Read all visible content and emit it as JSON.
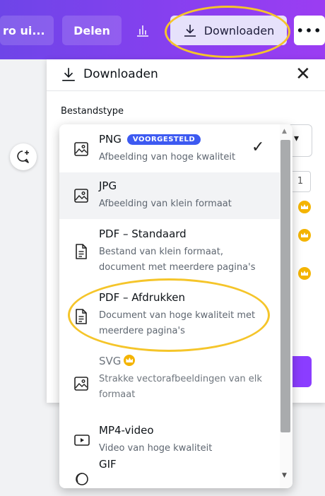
{
  "topbar": {
    "trial_label": "ro ui...",
    "share_label": "Delen",
    "insights_icon": "bar-chart-icon",
    "download_label": "Downloaden",
    "more_label": "•••"
  },
  "panel": {
    "title": "Downloaden",
    "filetype_label": "Bestandstype",
    "size_value": "1",
    "close_icon": "close-icon"
  },
  "file_types": [
    {
      "title": "PNG",
      "badge": "VOORGESTELD",
      "desc": "Afbeelding van hoge kwaliteit",
      "icon": "image-icon",
      "selected": true
    },
    {
      "title": "JPG",
      "desc": "Afbeelding van klein formaat",
      "icon": "image-icon"
    },
    {
      "title": "PDF – Standaard",
      "desc": "Bestand van klein formaat, document met meerdere pagina's",
      "icon": "document-icon"
    },
    {
      "title": "PDF – Afdrukken",
      "desc": "Document van hoge kwaliteit met meerdere pagina's",
      "icon": "document-icon"
    },
    {
      "title": "SVG",
      "desc": "Strakke vectorafbeeldingen van elk formaat",
      "icon": "image-icon",
      "pro": true
    },
    {
      "title": "MP4-video",
      "desc": "Video van hoge kwaliteit",
      "icon": "video-icon"
    },
    {
      "title": "GIF",
      "desc": "",
      "icon": "gif-icon"
    }
  ],
  "colors": {
    "brand_purple": "#8b3dff",
    "highlight": "#f5c52a",
    "badge_blue": "#3d5af1",
    "crown": "#f4b400"
  }
}
